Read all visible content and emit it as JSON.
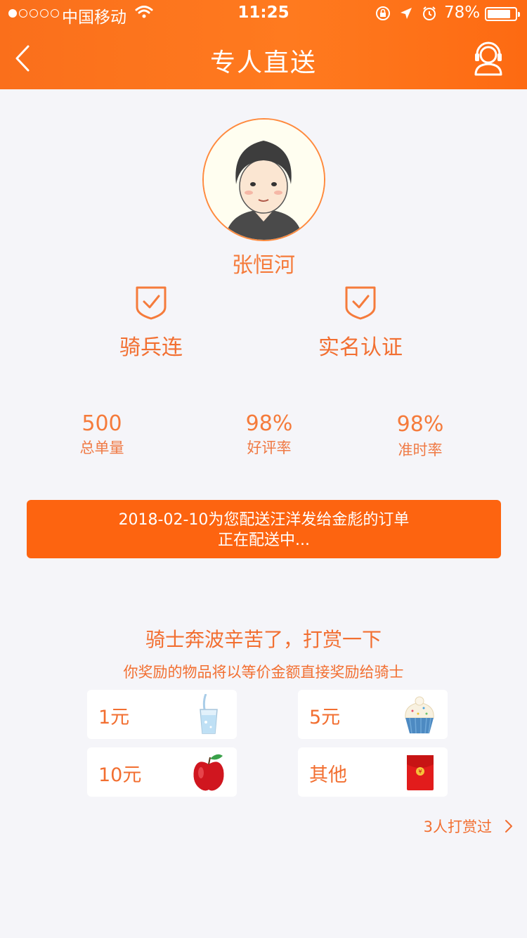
{
  "status_bar": {
    "carrier": "中国移动",
    "time": "11:25",
    "battery_percent": "78%",
    "battery_level": 0.78,
    "signal_bars_filled": 1,
    "signal_bars_total": 5
  },
  "nav": {
    "title": "专人直送",
    "back_icon": "chevron-left-icon",
    "support_icon": "headset-icon"
  },
  "courier": {
    "name": "张恒河",
    "badges": [
      {
        "label": "骑兵连",
        "icon": "shield-check-icon"
      },
      {
        "label": "实名认证",
        "icon": "shield-check-icon"
      }
    ],
    "stats": [
      {
        "value": "500",
        "caption": "总单量"
      },
      {
        "value": "98%",
        "caption": "好评率"
      },
      {
        "value": "98%",
        "caption": "准时率"
      }
    ]
  },
  "order_banner": {
    "line1": "2018-02-10为您配送汪洋发给金彪的订单",
    "line2": "正在配送中..."
  },
  "reward": {
    "title": "骑士奔波辛苦了，打赏一下",
    "subtitle": "你奖励的物品将以等价金额直接奖励给骑士",
    "options": [
      {
        "amount": "1元",
        "icon": "water-glass-icon"
      },
      {
        "amount": "5元",
        "icon": "cupcake-icon"
      },
      {
        "amount": "10元",
        "icon": "apple-icon"
      },
      {
        "amount": "其他",
        "icon": "red-envelope-icon"
      }
    ],
    "rewarded_count_link": "3人打赏过"
  },
  "colors": {
    "brand_orange": "#fd6410",
    "accent_text": "#f26f31",
    "background": "#f5f5f9"
  }
}
